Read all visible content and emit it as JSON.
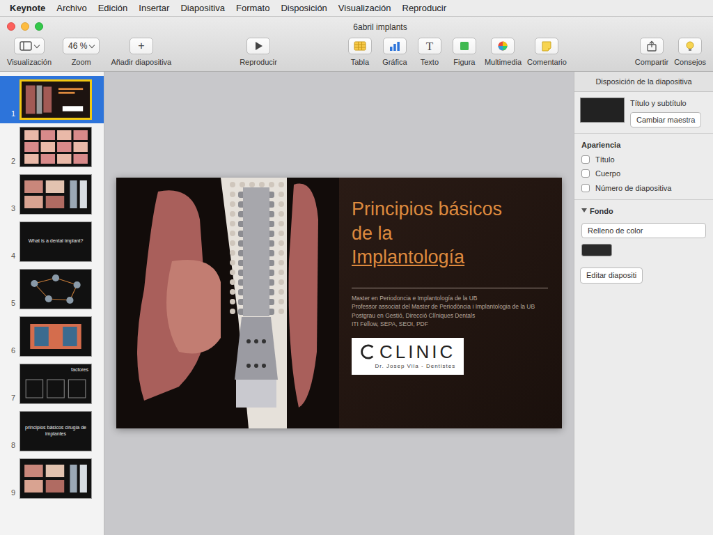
{
  "menu": [
    {
      "label": "Keynote",
      "app": true
    },
    {
      "label": "Archivo",
      "app": false
    },
    {
      "label": "Edición",
      "app": false
    },
    {
      "label": "Insertar",
      "app": false
    },
    {
      "label": "Diapositiva",
      "app": false
    },
    {
      "label": "Formato",
      "app": false
    },
    {
      "label": "Disposición",
      "app": false
    },
    {
      "label": "Visualización",
      "app": false
    },
    {
      "label": "Reproducir",
      "app": false
    }
  ],
  "document": {
    "title": "6abril implants"
  },
  "toolbar": {
    "left": [
      {
        "label": "Visualización",
        "kind": "menu",
        "icon": "view"
      },
      {
        "label": "Zoom",
        "kind": "select",
        "value": "46 %"
      },
      {
        "label": "Añadir diapositiva",
        "kind": "glyph",
        "glyph": "+"
      }
    ],
    "center": [
      {
        "label": "Reproducir",
        "kind": "icon",
        "icon": "play"
      }
    ],
    "insert": [
      {
        "label": "Tabla",
        "kind": "icon",
        "icon": "table"
      },
      {
        "label": "Gráfica",
        "kind": "icon",
        "icon": "chart"
      },
      {
        "label": "Texto",
        "kind": "glyph",
        "glyph": "T"
      },
      {
        "label": "Figura",
        "kind": "icon",
        "icon": "shape"
      },
      {
        "label": "Multimedia",
        "kind": "icon",
        "icon": "media"
      },
      {
        "label": "Comentario",
        "kind": "icon",
        "icon": "comment"
      }
    ],
    "right": [
      {
        "label": "Compartir",
        "kind": "icon",
        "icon": "share"
      },
      {
        "label": "Consejos",
        "kind": "icon",
        "icon": "tips"
      }
    ]
  },
  "slides": [
    {
      "number": "1",
      "selected": true,
      "kind": "title",
      "text": ""
    },
    {
      "number": "2",
      "selected": false,
      "kind": "grid",
      "text": ""
    },
    {
      "number": "3",
      "selected": false,
      "kind": "photos",
      "text": ""
    },
    {
      "number": "4",
      "selected": false,
      "kind": "text",
      "text": "What is a dental implant?"
    },
    {
      "number": "5",
      "selected": false,
      "kind": "diagram",
      "text": ""
    },
    {
      "number": "6",
      "selected": false,
      "kind": "photo",
      "text": ""
    },
    {
      "number": "7",
      "selected": false,
      "kind": "boxes",
      "text": "factores"
    },
    {
      "number": "8",
      "selected": false,
      "kind": "text",
      "text": "principios básicos cirugía de implantes"
    },
    {
      "number": "9",
      "selected": false,
      "kind": "photos",
      "text": ""
    }
  ],
  "slide": {
    "title": [
      {
        "text": "Principios básicos",
        "flagged": false
      },
      {
        "text": "de la",
        "flagged": false
      },
      {
        "text": "Implantología",
        "flagged": true
      }
    ],
    "credits": [
      "Master en Periodoncia e Implantología de la UB",
      "Professor associat del Master de Periodòncia i Implantologia de la UB",
      "Postgrau en Gestió, Direcció Clíniques Dentals",
      "ITI Fellow, SEPA, SEOI, PDF"
    ],
    "logo": {
      "name": "CLINIC",
      "subtitle": "Dr. Josep Vila - Dentistes"
    }
  },
  "inspector": {
    "header": "Disposición de la diapositiva",
    "layout": "Título y subtítulo",
    "change_master": "Cambiar maestra",
    "appearance": {
      "heading": "Apariencia",
      "options": [
        {
          "label": "Título",
          "checked": false
        },
        {
          "label": "Cuerpo",
          "checked": false
        },
        {
          "label": "Número de diapositiva",
          "checked": false
        }
      ]
    },
    "background": {
      "heading": "Fondo",
      "expanded": true,
      "fill": "Relleno de color"
    },
    "edit_button": "Editar diapositi"
  }
}
